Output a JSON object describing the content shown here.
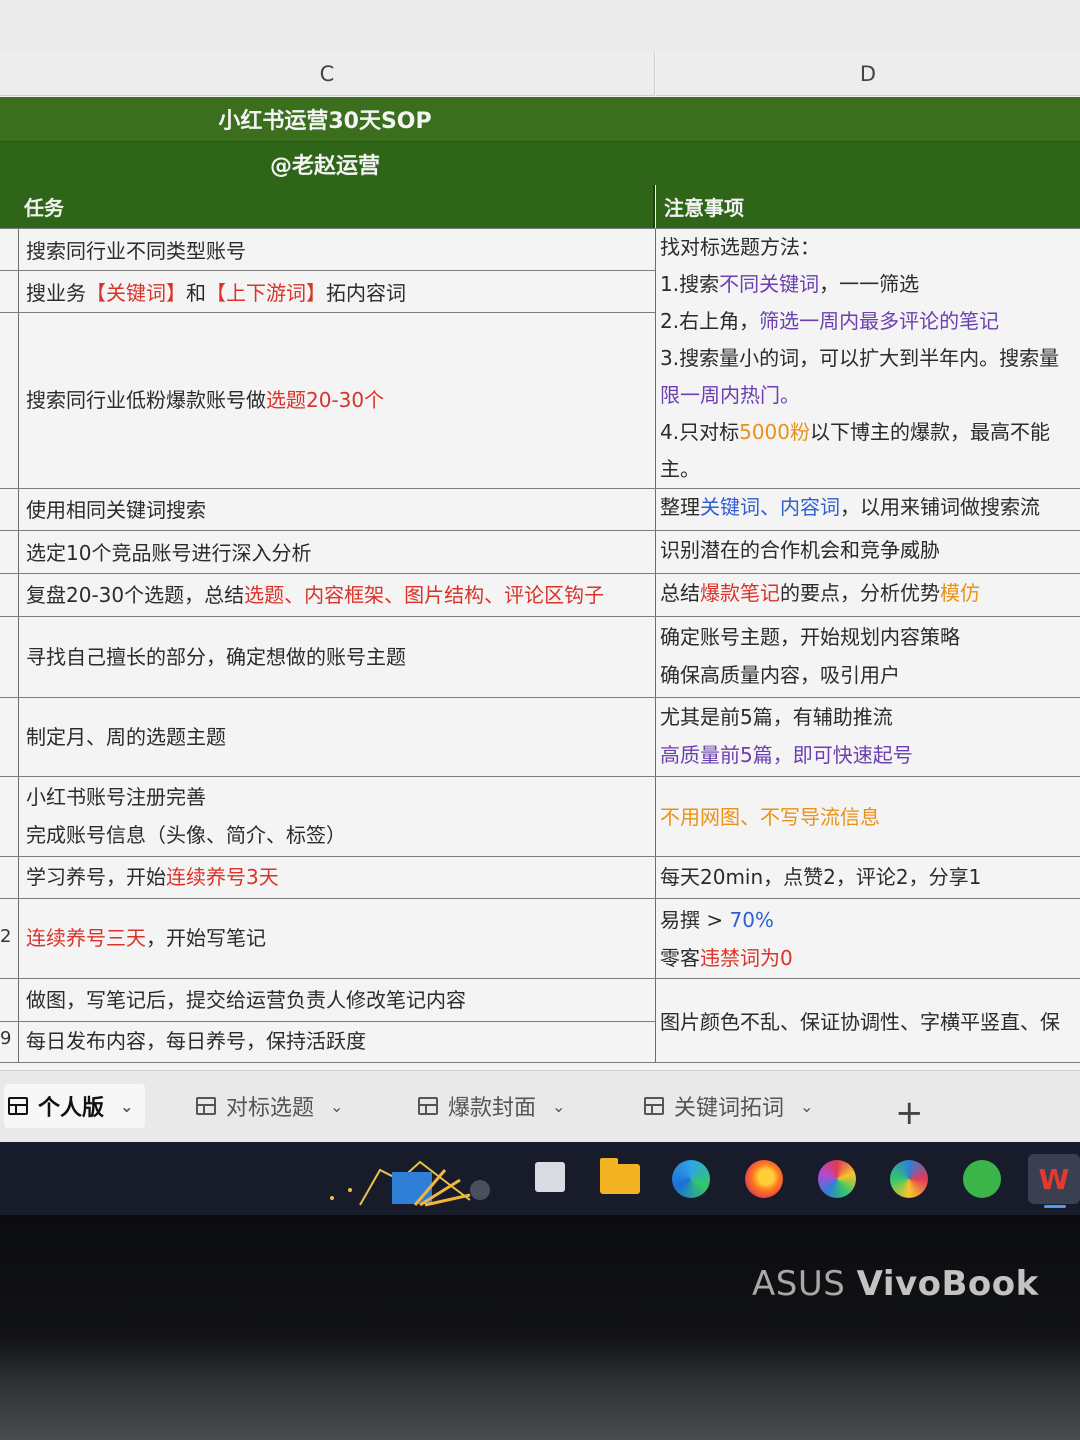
{
  "columns": {
    "c": "C",
    "d": "D"
  },
  "sheet": {
    "title": "小红书运营30天SOP",
    "subtitle": "@老赵运营",
    "header_task": "任务",
    "header_notes": "注意事项"
  },
  "rows": {
    "r1": {
      "task": "搜索同行业不同类型账号"
    },
    "r2": {
      "task_a": "搜业务",
      "task_b": "【关键词】",
      "task_c": "和",
      "task_d": "【上下游词】",
      "task_e": "拓内容词"
    },
    "r3": {
      "task_a": "搜索同行业低粉爆款账号做",
      "task_b": "选题20-30个"
    },
    "notes_1_3": {
      "l1": "找对标选题方法：",
      "l2a": "1.搜索",
      "l2b": "不同关键词",
      "l2c": "，一一筛选",
      "l3a": "2.右上角，",
      "l3b": "筛选一周内最多评论的笔记",
      "l4": "3.搜索量小的词，可以扩大到半年内。搜索量",
      "l5": "限一周内热门。",
      "l6a": "4.只对标",
      "l6b": "5000粉",
      "l6c": "以下博主的爆款，最高不能",
      "l7": "主。"
    },
    "r4": {
      "task": "使用相同关键词搜索",
      "note_a": "整理",
      "note_b": "关键词、内容词",
      "note_c": "，以用来铺词做搜索流"
    },
    "r5": {
      "task": "选定10个竞品账号进行深入分析",
      "note": "识别潜在的合作机会和竞争威胁"
    },
    "r6": {
      "task_a": "复盘20-30个选题，总结",
      "task_b": "选题、内容框架、图片结构、评论区钩子",
      "note_a": "总结",
      "note_b": "爆款笔记",
      "note_c": "的要点，分析优势",
      "note_d": "模仿"
    },
    "r7": {
      "task": "寻找自己擅长的部分，确定想做的账号主题",
      "note_l1": "确定账号主题，开始规划内容策略",
      "note_l2": "确保高质量内容，吸引用户"
    },
    "r8": {
      "task": "制定月、周的选题主题",
      "note_l1": "尤其是前5篇，有辅助推流",
      "note_l2": "高质量前5篇，即可快速起号"
    },
    "r9": {
      "task_l1": "小红书账号注册完善",
      "task_l2": "完成账号信息（头像、简介、标签）",
      "note": "不用网图、不写导流信息"
    },
    "r10": {
      "task_a": "学习养号，开始",
      "task_b": "连续养号3天",
      "note": "每天20min，点赞2，评论2，分享1"
    },
    "r11": {
      "rownum": "2",
      "task_a": "连续养号三天",
      "task_b": "，开始写笔记",
      "note_l1a": "易撰 > ",
      "note_l1b": "70%",
      "note_l2a": "零客",
      "note_l2b": "违禁词为0"
    },
    "r12": {
      "task": "做图，写笔记后，提交给运营负责人修改笔记内容",
      "note": "图片颜色不乱、保证协调性、字横平竖直、保"
    },
    "r13": {
      "rownum": "9",
      "task": "每日发布内容，每日养号，保持活跃度"
    }
  },
  "tabs": [
    {
      "label": "个人版",
      "active": true
    },
    {
      "label": "对标选题",
      "active": false
    },
    {
      "label": "爆款封面",
      "active": false
    },
    {
      "label": "关键词拓词",
      "active": false
    }
  ],
  "add_tab_label": "+",
  "taskbar_icons": [
    "widgets-icon",
    "task-view-icon",
    "file-explorer-icon",
    "edge-icon",
    "firefox-icon",
    "browser-icon",
    "browser-icon-2",
    "ie-icon",
    "wps-icon"
  ],
  "laptop_brand": {
    "maker": "ASUS",
    "model": "VivoBook"
  },
  "colors": {
    "header_green": "#2f6519",
    "accent_red": "#d9332a",
    "accent_blue": "#2f5fd0",
    "accent_orange": "#e8921a",
    "accent_purple": "#6b3fb0"
  }
}
